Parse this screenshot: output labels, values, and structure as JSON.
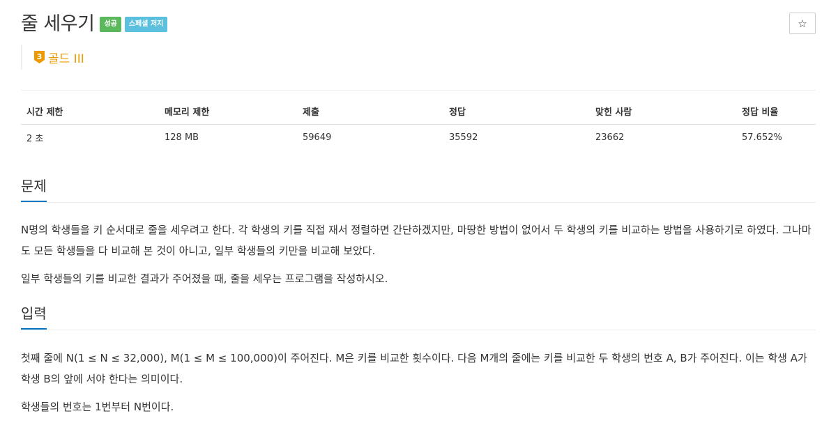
{
  "problem": {
    "title": "줄 세우기",
    "labels": [
      "성공",
      "스페셜 저지"
    ],
    "tier": "골드 III",
    "tier_number": "3",
    "star_icon": "☆"
  },
  "info_table": {
    "headers": [
      "시간 제한",
      "메모리 제한",
      "제출",
      "정답",
      "맞힌 사람",
      "정답 비율"
    ],
    "values": [
      "2 초",
      "128 MB",
      "59649",
      "35592",
      "23662",
      "57.652%"
    ]
  },
  "sections": {
    "description": {
      "title": "문제",
      "paragraphs": [
        "N명의 학생들을 키 순서대로 줄을 세우려고 한다. 각 학생의 키를 직접 재서 정렬하면 간단하겠지만, 마땅한 방법이 없어서 두 학생의 키를 비교하는 방법을 사용하기로 하였다. 그나마도 모든 학생들을 다 비교해 본 것이 아니고, 일부 학생들의 키만을 비교해 보았다.",
        "일부 학생들의 키를 비교한 결과가 주어졌을 때, 줄을 세우는 프로그램을 작성하시오."
      ]
    },
    "input": {
      "title": "입력",
      "paragraphs": [
        "첫째 줄에 N(1 ≤ N ≤ 32,000), M(1 ≤ M ≤ 100,000)이 주어진다. M은 키를 비교한 횟수이다. 다음 M개의 줄에는 키를 비교한 두 학생의 번호 A, B가 주어진다. 이는 학생 A가 학생 B의 앞에 서야 한다는 의미이다.",
        "학생들의 번호는 1번부터 N번이다."
      ]
    }
  },
  "colors": {
    "success": "#5cb85c",
    "info": "#5bc0de",
    "tier_gold": "#ec9a00",
    "section_underline": "#0076c0"
  }
}
